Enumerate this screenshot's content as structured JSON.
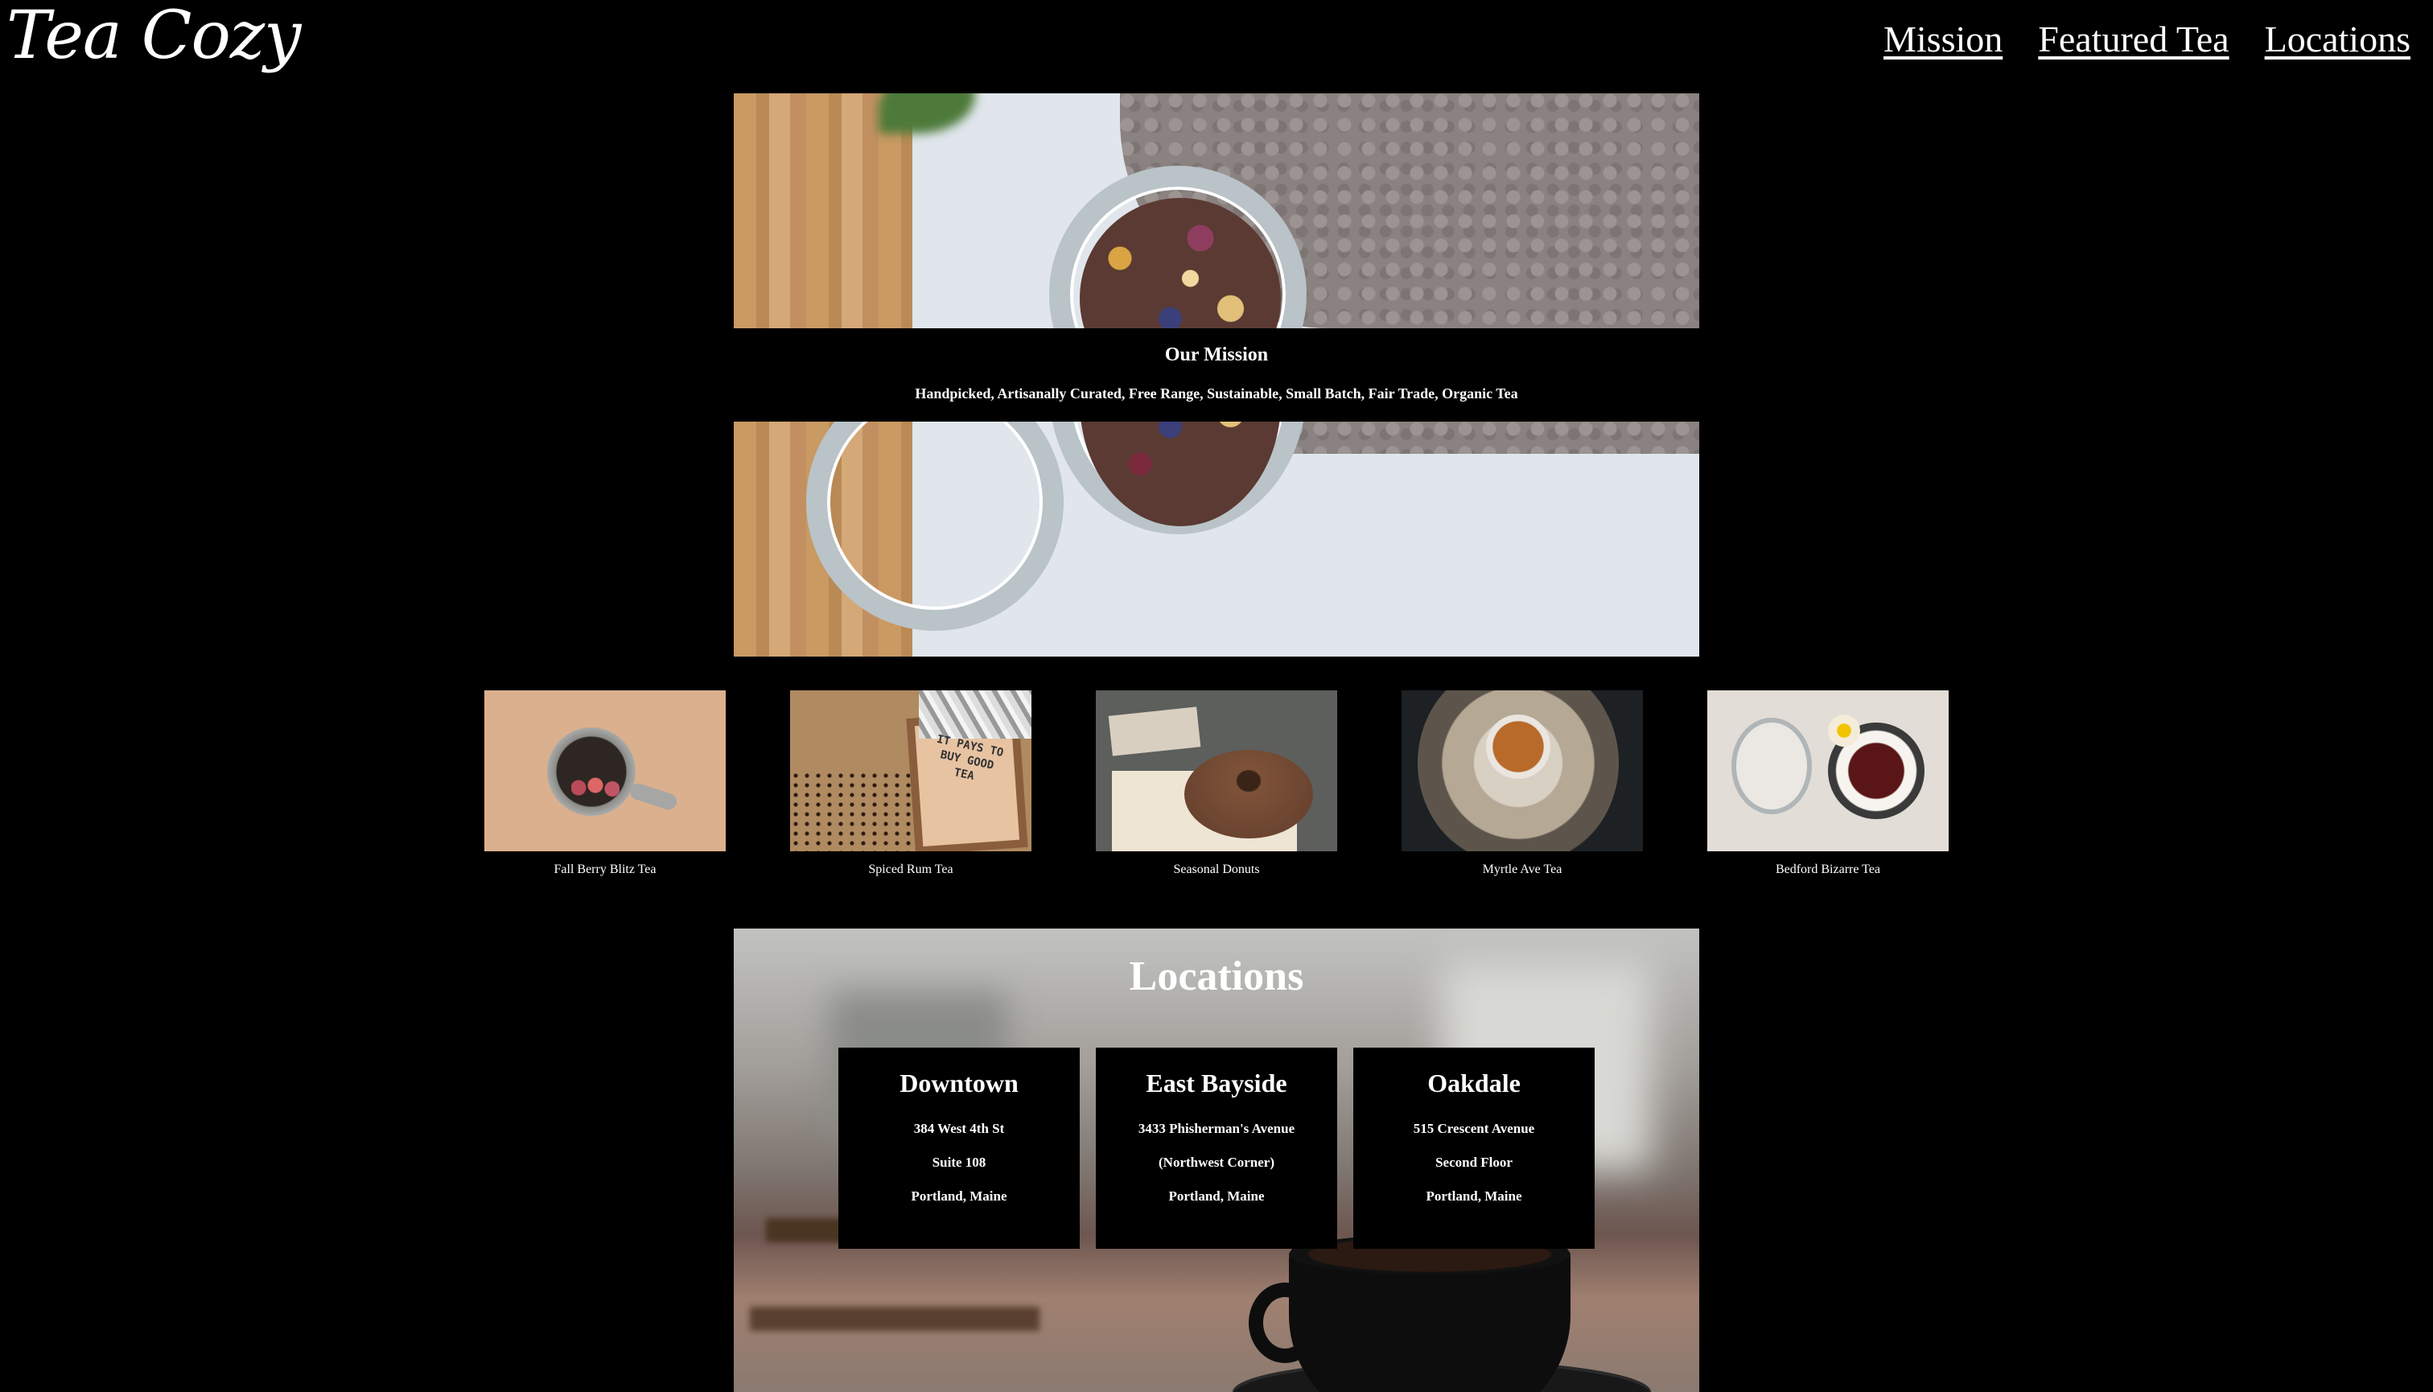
{
  "header": {
    "logo": "Tea Cozy",
    "nav": [
      {
        "label": "Mission"
      },
      {
        "label": "Featured Tea"
      },
      {
        "label": "Locations"
      }
    ]
  },
  "mission": {
    "title": "Our Mission",
    "subtitle": "Handpicked, Artisanally Curated, Free Range, Sustainable, Small Batch, Fair Trade, Organic Tea"
  },
  "featured": [
    {
      "caption": "Fall Berry Blitz Tea"
    },
    {
      "caption": "Spiced Rum Tea"
    },
    {
      "caption": "Seasonal Donuts"
    },
    {
      "caption": "Myrtle Ave Tea"
    },
    {
      "caption": "Bedford Bizarre Tea"
    }
  ],
  "featured_image_text": "IT PAYS TO BUY GOOD TEA",
  "locations": {
    "title": "Locations",
    "items": [
      {
        "name": "Downtown",
        "lines": [
          "384 West 4th St",
          "Suite 108",
          "Portland, Maine"
        ]
      },
      {
        "name": "East Bayside",
        "lines": [
          "3433 Phisherman's Avenue",
          "(Northwest Corner)",
          "Portland, Maine"
        ]
      },
      {
        "name": "Oakdale",
        "lines": [
          "515 Crescent Avenue",
          "Second Floor",
          "Portland, Maine"
        ]
      }
    ]
  },
  "colors": {
    "background": "#000000",
    "text": "#ffffff"
  }
}
